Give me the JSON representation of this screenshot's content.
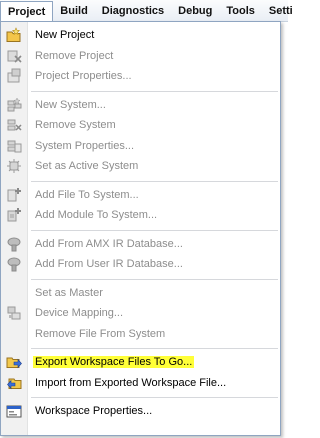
{
  "menubar": {
    "items": [
      "Project",
      "Build",
      "Diagnostics",
      "Debug",
      "Tools",
      "Setti"
    ]
  },
  "menu": {
    "group1": [
      {
        "label": "New Project",
        "icon": "new-project-icon",
        "enabled": true
      },
      {
        "label": "Remove Project",
        "icon": "remove-project-icon",
        "enabled": false
      },
      {
        "label": "Project Properties...",
        "icon": "project-properties-icon",
        "enabled": false
      }
    ],
    "group2": [
      {
        "label": "New System...",
        "icon": "new-system-icon",
        "enabled": false
      },
      {
        "label": "Remove System",
        "icon": "remove-system-icon",
        "enabled": false
      },
      {
        "label": "System Properties...",
        "icon": "system-properties-icon",
        "enabled": false
      },
      {
        "label": "Set as Active System",
        "icon": "active-system-icon",
        "enabled": false
      }
    ],
    "group3": [
      {
        "label": "Add File To System...",
        "icon": "add-file-icon",
        "enabled": false
      },
      {
        "label": "Add Module To System...",
        "icon": "add-module-icon",
        "enabled": false
      }
    ],
    "group4": [
      {
        "label": "Add From AMX IR Database...",
        "icon": "amx-ir-database-icon",
        "enabled": false
      },
      {
        "label": "Add From User IR Database...",
        "icon": "user-ir-database-icon",
        "enabled": false
      }
    ],
    "group5": [
      {
        "label": "Set as Master",
        "icon": "",
        "enabled": false
      },
      {
        "label": "Device Mapping...",
        "icon": "device-mapping-icon",
        "enabled": false
      },
      {
        "label": "Remove File From System",
        "icon": "",
        "enabled": false
      }
    ],
    "group6": [
      {
        "label": "Export Workspace Files To Go...",
        "icon": "export-folder-icon",
        "enabled": true,
        "highlighted": true
      },
      {
        "label": "Import from Exported Workspace File...",
        "icon": "import-folder-icon",
        "enabled": true
      }
    ],
    "group7": [
      {
        "label": "Workspace Properties...",
        "icon": "workspace-properties-icon",
        "enabled": true
      }
    ]
  },
  "colors": {
    "highlight": "#ffff38",
    "disabled_text": "#8d8d8d",
    "menu_border": "#8fa5c1",
    "gutter": "#f1f1f1"
  }
}
